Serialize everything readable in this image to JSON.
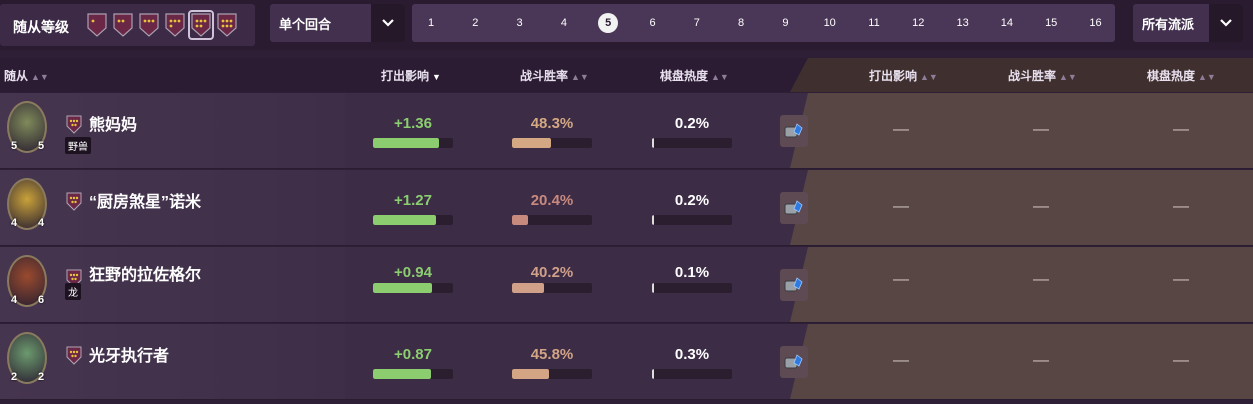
{
  "topbar": {
    "tier_label": "随从等级",
    "tier_count": 6,
    "tier_selected_index": 4,
    "round_dropdown": "单个回合",
    "turns": [
      "1",
      "2",
      "3",
      "4",
      "5",
      "6",
      "7",
      "8",
      "9",
      "10",
      "11",
      "12",
      "13",
      "14",
      "15",
      "16"
    ],
    "selected_turn": "5",
    "archetype_dropdown": "所有流派"
  },
  "header": {
    "minion": "随从",
    "impact": "打出影响",
    "winrate": "战斗胜率",
    "heat": "棋盘热度",
    "impact2": "打出影响",
    "winrate2": "战斗胜率",
    "heat2": "棋盘热度"
  },
  "rows": [
    {
      "name": "熊妈妈",
      "tag": "野兽",
      "attack": "5",
      "health": "5",
      "impact": "+1.36",
      "impact_pct": 0.82,
      "winrate": "48.3%",
      "winrate_pct": 0.483,
      "winrate_color": "#d4a882",
      "heat": "0.2%",
      "heat_pct": 0.02,
      "avatar_color": "#7f8a5a",
      "dash": "—"
    },
    {
      "name": "“厨房煞星”诺米",
      "tag": "",
      "attack": "4",
      "health": "4",
      "impact": "+1.27",
      "impact_pct": 0.79,
      "winrate": "20.4%",
      "winrate_pct": 0.204,
      "winrate_color": "#c98a7e",
      "heat": "0.2%",
      "heat_pct": 0.02,
      "avatar_color": "#c9a23a",
      "dash": "—"
    },
    {
      "name": "狂野的拉佐格尔",
      "tag": "龙",
      "attack": "4",
      "health": "6",
      "impact": "+0.94",
      "impact_pct": 0.74,
      "winrate": "40.2%",
      "winrate_pct": 0.402,
      "winrate_color": "#d1a089",
      "heat": "0.1%",
      "heat_pct": 0.01,
      "avatar_color": "#9a4a2e",
      "dash": "—"
    },
    {
      "name": "光牙执行者",
      "tag": "",
      "attack": "2",
      "health": "2",
      "impact": "+0.87",
      "impact_pct": 0.72,
      "winrate": "45.8%",
      "winrate_pct": 0.458,
      "winrate_color": "#d3a585",
      "heat": "0.3%",
      "heat_pct": 0.03,
      "avatar_color": "#6c9a6e",
      "dash": "—"
    }
  ],
  "colors": {
    "impact": "#8bcd6f",
    "impact_text": "#8bcd6f",
    "heat_text": "#ffffff"
  }
}
